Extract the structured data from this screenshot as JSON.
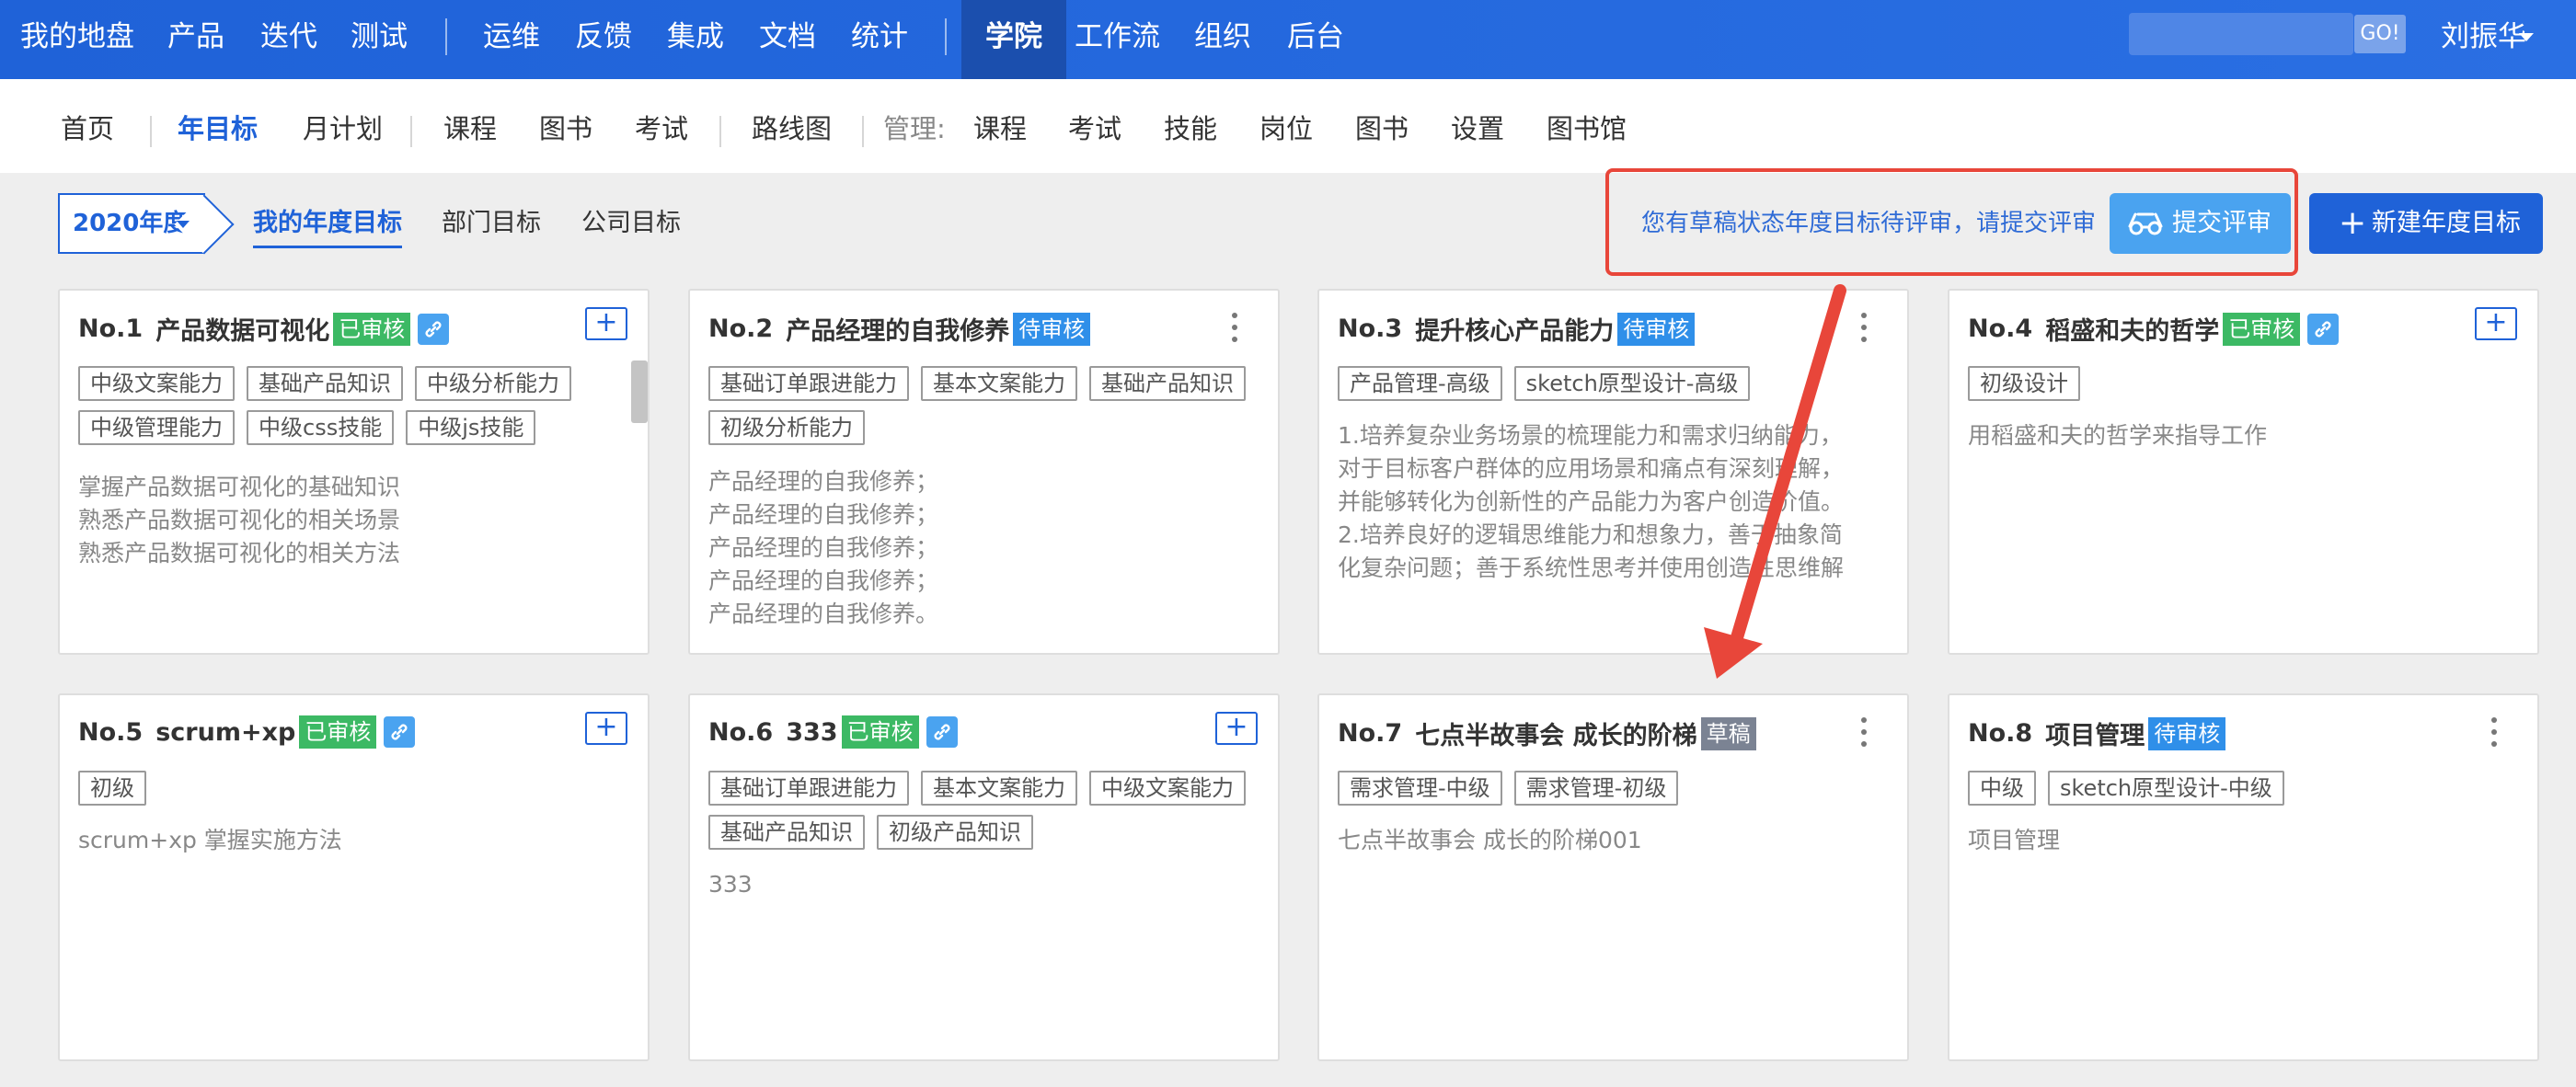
{
  "topnav": {
    "items": [
      "我的地盘",
      "产品",
      "迭代",
      "测试",
      "运维",
      "反馈",
      "集成",
      "文档",
      "统计",
      "学院",
      "工作流",
      "组织",
      "后台"
    ],
    "search_go": "GO!",
    "user": "刘振华"
  },
  "subnav": {
    "items": [
      "首页",
      "年目标",
      "月计划",
      "课程",
      "图书",
      "考试",
      "路线图"
    ],
    "manage_label": "管理:",
    "manage_items": [
      "课程",
      "考试",
      "技能",
      "岗位",
      "图书",
      "设置",
      "图书馆"
    ]
  },
  "toolbar": {
    "year": "2020年度",
    "tabs": [
      "我的年度目标",
      "部门目标",
      "公司目标"
    ],
    "notice": "您有草稿状态年度目标待评审，请提交评审",
    "submit_label": "提交评审",
    "new_label": "新建年度目标"
  },
  "cards": [
    {
      "no": "No.1",
      "title": "产品数据可视化",
      "status": "已审核",
      "tags": [
        "中级文案能力",
        "基础产品知识",
        "中级分析能力",
        "中级管理能力",
        "中级css技能",
        "中级js技能"
      ],
      "desc": [
        "掌握产品数据可视化的基础知识",
        "熟悉产品数据可视化的相关场景",
        "熟悉产品数据可视化的相关方法"
      ]
    },
    {
      "no": "No.2",
      "title": "产品经理的自我修养",
      "status": "待审核",
      "tags": [
        "基础订单跟进能力",
        "基本文案能力",
        "基础产品知识",
        "初级分析能力"
      ],
      "desc": [
        "产品经理的自我修养；",
        "产品经理的自我修养；",
        "产品经理的自我修养；",
        "产品经理的自我修养；",
        "产品经理的自我修养。"
      ]
    },
    {
      "no": "No.3",
      "title": "提升核心产品能力",
      "status": "待审核",
      "tags": [
        "产品管理-高级",
        "sketch原型设计-高级"
      ],
      "desc": [
        "1.培养复杂业务场景的梳理能力和需求归纳能力，",
        "对于目标客户群体的应用场景和痛点有深刻理解，",
        "并能够转化为创新性的产品能力为客户创造价值。",
        "2.培养良好的逻辑思维能力和想象力，善于抽象简",
        "化复杂问题；善于系统性思考并使用创造性思维解"
      ]
    },
    {
      "no": "No.4",
      "title": "稻盛和夫的哲学",
      "status": "已审核",
      "tags": [
        "初级设计"
      ],
      "desc": [
        "用稻盛和夫的哲学来指导工作"
      ]
    },
    {
      "no": "No.5",
      "title": "scrum+xp",
      "status": "已审核",
      "tags": [
        "初级"
      ],
      "desc": [
        "scrum+xp 掌握实施方法"
      ]
    },
    {
      "no": "No.6",
      "title": "333",
      "status": "已审核",
      "tags": [
        "基础订单跟进能力",
        "基本文案能力",
        "中级文案能力",
        "基础产品知识",
        "初级产品知识"
      ],
      "desc": [
        "333"
      ]
    },
    {
      "no": "No.7",
      "title": "七点半故事会 成长的阶梯",
      "status": "草稿",
      "tags": [
        "需求管理-中级",
        "需求管理-初级"
      ],
      "desc": [
        "七点半故事会 成长的阶梯001"
      ]
    },
    {
      "no": "No.8",
      "title": "项目管理",
      "status": "待审核",
      "tags": [
        "中级",
        "sketch原型设计-中级"
      ],
      "desc": [
        "项目管理"
      ]
    }
  ],
  "colors": {
    "primary": "#1f62d8",
    "approved": "#3cb964",
    "pending": "#2f8fe9",
    "draft": "#7b8393",
    "highlight": "#e8463a"
  }
}
